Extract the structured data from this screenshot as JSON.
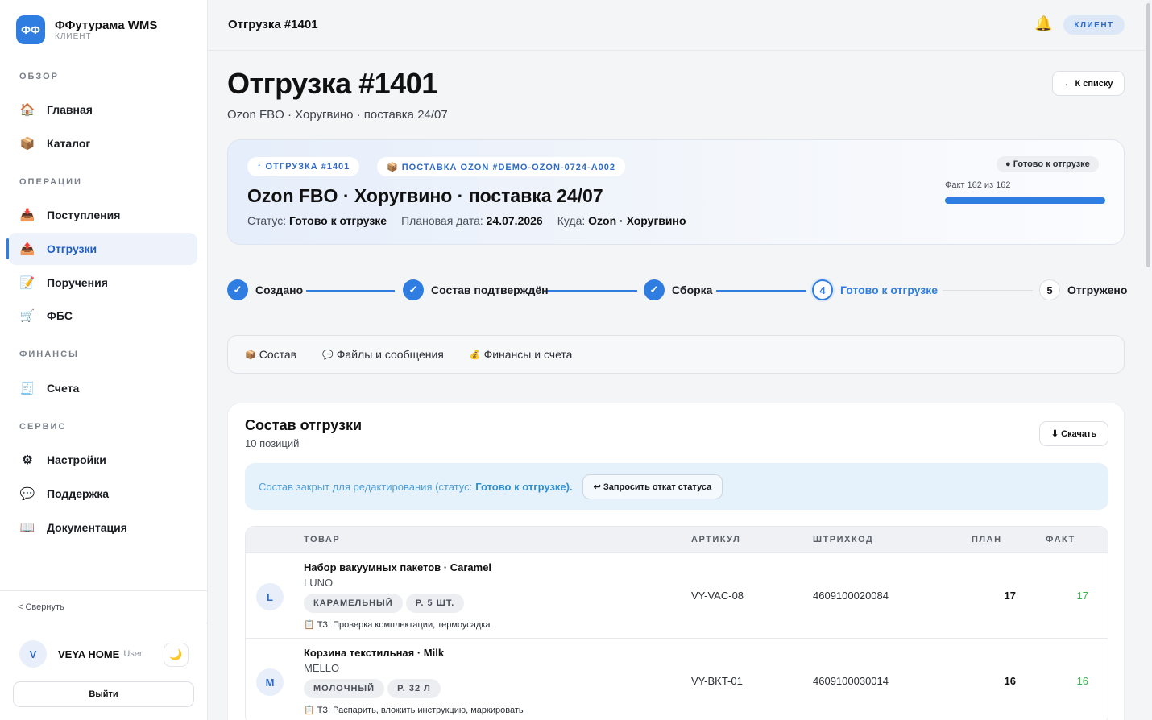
{
  "brand": {
    "logo": "ФФ",
    "name": "ФФутурама WMS",
    "subtitle": "КЛИЕНТ"
  },
  "sidebar": {
    "sections": [
      {
        "title": "ОБЗОР"
      },
      {
        "title": "ОПЕРАЦИИ"
      },
      {
        "title": "ФИНАНСЫ"
      },
      {
        "title": "СЕРВИС"
      }
    ],
    "items": [
      {
        "label": "Главная",
        "icon": "🏠",
        "icon_name": "home-icon"
      },
      {
        "label": "Каталог",
        "icon": "📦",
        "icon_name": "box-icon"
      },
      {
        "label": "Поступления",
        "icon": "📥",
        "icon_name": "inbox-icon"
      },
      {
        "label": "Отгрузки",
        "icon": "📤",
        "icon_name": "outbox-icon",
        "active": true
      },
      {
        "label": "Поручения",
        "icon": "📝",
        "icon_name": "memo-icon"
      },
      {
        "label": "ФБС",
        "icon": "🛒",
        "icon_name": "cart-icon"
      },
      {
        "label": "Счета",
        "icon": "🧾",
        "icon_name": "receipt-icon"
      },
      {
        "label": "Настройки",
        "icon": "⚙",
        "icon_name": "gear-icon"
      },
      {
        "label": "Поддержка",
        "icon": "💬",
        "icon_name": "chat-icon"
      },
      {
        "label": "Документация",
        "icon": "📖",
        "icon_name": "book-icon"
      }
    ],
    "collapse_label": "<  Свернуть",
    "user": {
      "initial": "V",
      "name": "VEYA HOME",
      "role": "User"
    },
    "theme_icon": "🌙",
    "logout_label": "Выйти"
  },
  "topbar": {
    "title": "Отгрузка #1401",
    "bell_icon": "🔔",
    "role_badge": "КЛИЕНТ"
  },
  "page": {
    "title": "Отгрузка #1401",
    "subtitle": "Ozon FBO · Хоругвино · поставка 24/07",
    "back_label": "← К списку"
  },
  "summary": {
    "tag_shipment": "↑ ОТГРУЗКА #1401",
    "tag_supply": "📦 ПОСТАВКА OZON #DEMO-OZON-0724-A002",
    "title": "Ozon FBO · Хоругвино · поставка 24/07",
    "status_label": "Статус:",
    "status_value": "Готово к отгрузке",
    "date_label": "Плановая дата:",
    "date_value": "24.07.2026",
    "dest_label": "Куда:",
    "dest_value": "Ozon · Хоругвино",
    "status_chip": "● Готово к отгрузке",
    "fact_text": "Факт 162 из 162",
    "progress": 1.0
  },
  "stepper": {
    "steps": [
      {
        "label": "Создано",
        "mark": "✓",
        "state": "done"
      },
      {
        "label": "Состав подтверждён",
        "mark": "✓",
        "state": "done"
      },
      {
        "label": "Сборка",
        "mark": "✓",
        "state": "done"
      },
      {
        "label": "Готово к отгрузке",
        "mark": "4",
        "state": "current"
      },
      {
        "label": "Отгружено",
        "mark": "5",
        "state": "todo"
      }
    ]
  },
  "tabs": [
    {
      "label": "Состав",
      "icon": "📦"
    },
    {
      "label": "Файлы и сообщения",
      "icon": "💬"
    },
    {
      "label": "Финансы и счета",
      "icon": "💰"
    }
  ],
  "composition": {
    "title": "Состав отгрузки",
    "subtitle": "10 позиций",
    "download_label": "⬇ Скачать",
    "notice_text": "Состав закрыт для редактирования (статус:",
    "notice_status": "Готово к отгрузке).",
    "rollback_label": "↩ Запросить откат статуса",
    "columns": {
      "product": "ТОВАР",
      "sku": "АРТИКУЛ",
      "barcode": "ШТРИХКОД",
      "plan": "ПЛАН",
      "fact": "ФАКТ"
    },
    "rows": [
      {
        "initial": "L",
        "name": "Набор вакуумных пакетов · Caramel",
        "brand": "LUNO",
        "chip1": "КАРАМЕЛЬНЫЙ",
        "chip2": "Р. 5 ШТ.",
        "note": "📋 ТЗ: Проверка комплектации, термоусадка",
        "sku": "VY-VAC-08",
        "barcode": "4609100020084",
        "plan": "17",
        "fact": "17"
      },
      {
        "initial": "M",
        "name": "Корзина текстильная · Milk",
        "brand": "MELLO",
        "chip1": "МОЛОЧНЫЙ",
        "chip2": "Р. 32 Л",
        "note": "📋 ТЗ: Распарить, вложить инструкцию, маркировать",
        "sku": "VY-BKT-01",
        "barcode": "4609100030014",
        "plan": "16",
        "fact": "16"
      }
    ]
  }
}
